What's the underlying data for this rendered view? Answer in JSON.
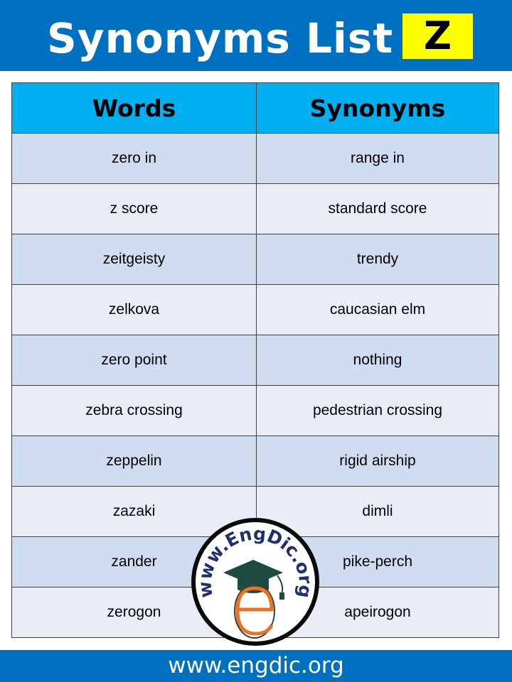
{
  "header": {
    "title": "Synonyms List",
    "letter": "Z",
    "colors": {
      "background": "#0070c0",
      "badge": "#ffff00"
    }
  },
  "table": {
    "columns": [
      "Words",
      "Synonyms"
    ],
    "rows": [
      {
        "word": "zero in",
        "synonym": "range in"
      },
      {
        "word": "z score",
        "synonym": "standard score"
      },
      {
        "word": "zeitgeisty",
        "synonym": "trendy"
      },
      {
        "word": "zelkova",
        "synonym": "caucasian elm"
      },
      {
        "word": "zero point",
        "synonym": "nothing"
      },
      {
        "word": "zebra crossing",
        "synonym": "pedestrian crossing"
      },
      {
        "word": "zeppelin",
        "synonym": "rigid airship"
      },
      {
        "word": "zazaki",
        "synonym": "dimli"
      },
      {
        "word": "zander",
        "synonym": "pike-perch"
      },
      {
        "word": "zerogon",
        "synonym": "apeirogon"
      }
    ],
    "colors": {
      "header": "#00b0f0",
      "row_odd": "#d0dcef",
      "row_even": "#e9edf6"
    }
  },
  "logo": {
    "text": "www.EngDic.org",
    "icon": "graduation-cap-e-icon"
  },
  "footer": {
    "url": "www.engdic.org"
  }
}
